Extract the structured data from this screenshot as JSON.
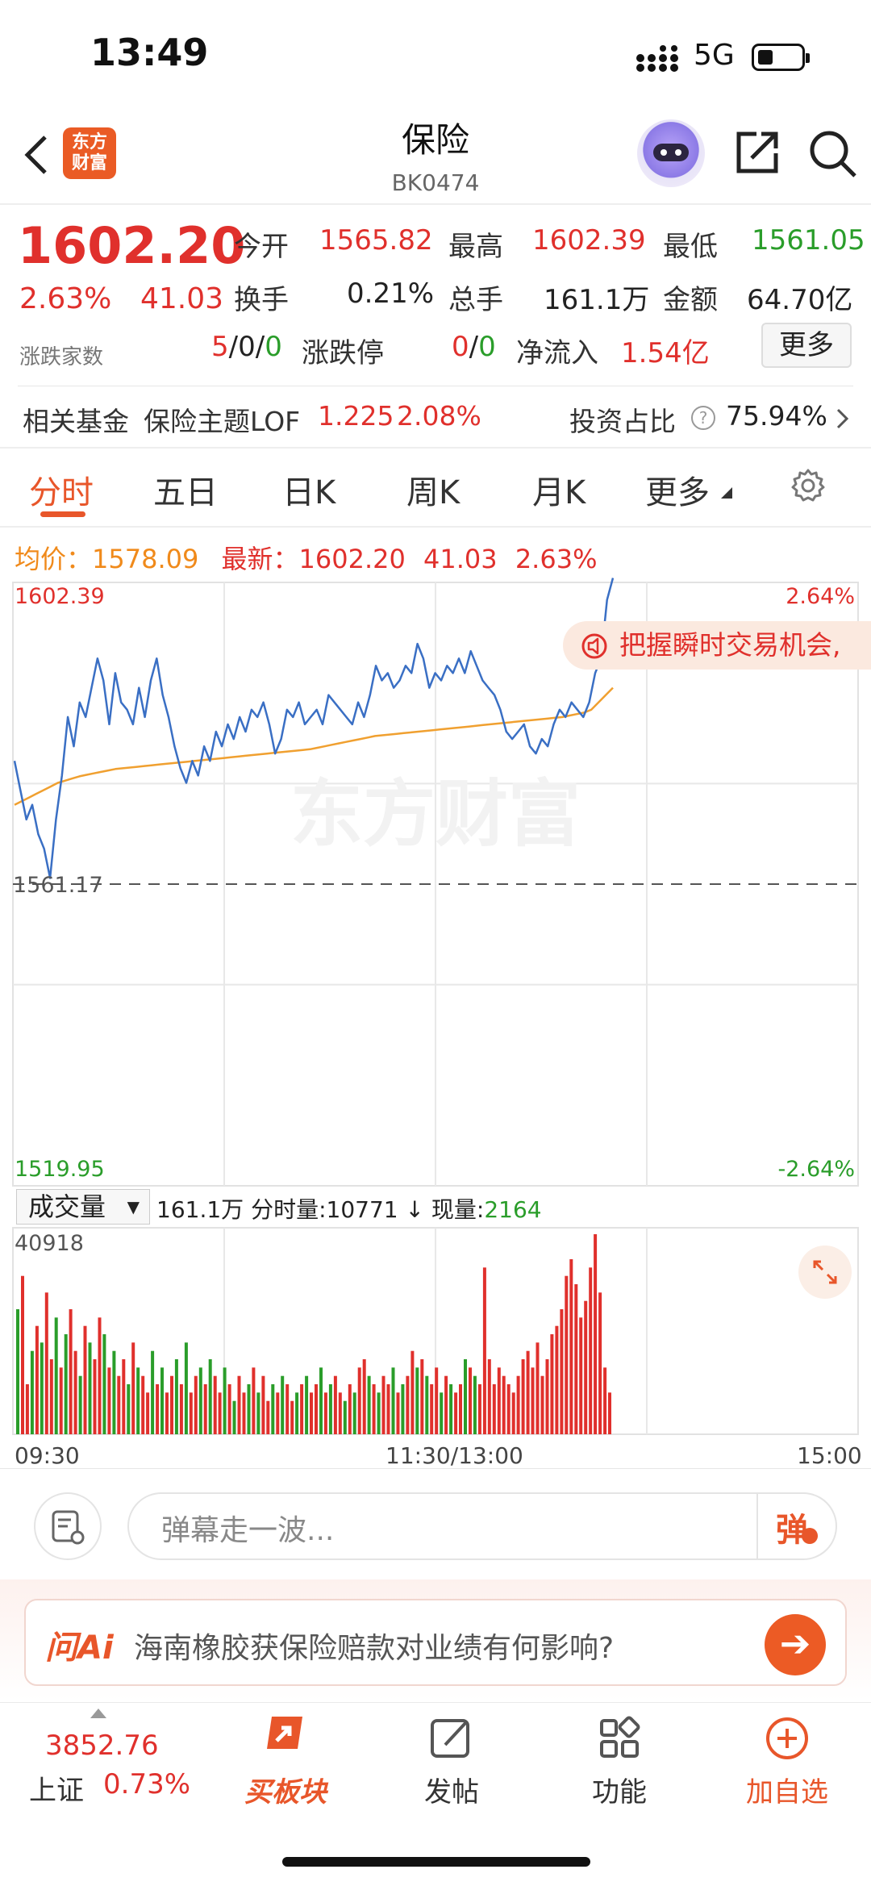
{
  "status_bar": {
    "time": "13:49",
    "network": "5G"
  },
  "header": {
    "logo_text": "东方\n财富",
    "title": "保险",
    "code": "BK0474"
  },
  "quote": {
    "price": "1602.20",
    "change_pct": "2.63%",
    "change": "41.03",
    "rows": [
      [
        {
          "label": "今开",
          "value": "1565.82",
          "color": "#e0302c"
        },
        {
          "label": "最高",
          "value": "1602.39",
          "color": "#e0302c"
        },
        {
          "label": "最低",
          "value": "1561.05",
          "color": "#2a9d2a"
        }
      ],
      [
        {
          "label": "换手",
          "value": "0.21%",
          "color": "#222222"
        },
        {
          "label": "总手",
          "value": "161.1万",
          "color": "#222222"
        },
        {
          "label": "金额",
          "value": "64.70亿",
          "color": "#222222"
        }
      ]
    ],
    "breadth_label": "涨跌家数",
    "breadth": {
      "up": "5",
      "flat": "0",
      "down": "0"
    },
    "limit_label": "涨跌停",
    "limit": {
      "up": "0",
      "down": "0"
    },
    "inflow_label": "净流入",
    "inflow": "1.54亿",
    "more_label": "更多"
  },
  "fund": {
    "label": "相关基金",
    "name": "保险主题LOF",
    "price": "1.225",
    "pct": "2.08%",
    "ratio_label": "投资占比",
    "ratio": "75.94%"
  },
  "tabs": [
    "分时",
    "五日",
    "日K",
    "周K",
    "月K",
    "更多"
  ],
  "avg_row": {
    "avg_label": "均价：",
    "avg": "1578.09",
    "latest_label": "最新：",
    "latest": "1602.20",
    "chg": "41.03",
    "pct": "2.63%"
  },
  "chart_labels": {
    "y_top": "1602.39",
    "y_pre": "1561.17",
    "y_bot": "1519.95",
    "pct_top": "2.64%",
    "pct_bot": "-2.64%",
    "watermark": "东方财富"
  },
  "banner_text": "把握瞬时交易机会,",
  "volume": {
    "select": "成交量",
    "total": "161.1万",
    "minute_label": "分时量:",
    "minute": "10771",
    "arrow": "↓",
    "now_label": "现量:",
    "now": "2164",
    "max": "40918"
  },
  "time_axis": {
    "start": "09:30",
    "mid": "11:30/13:00",
    "end": "15:00"
  },
  "danmaku": {
    "placeholder": "弹幕走一波...",
    "button": "弹"
  },
  "ai": {
    "logo": "问Ai",
    "question": "海南橡胶获保险赔款对业绩有何影响?"
  },
  "nav": {
    "index_value": "3852.76",
    "index_name": "上证",
    "index_pct": "0.73%",
    "items": [
      "买板块",
      "发帖",
      "功能",
      "加自选"
    ]
  },
  "colors": {
    "up": "#e0302c",
    "down": "#2a9d2a",
    "accent": "#e8562a",
    "price_line": "#3a6fc4",
    "avg_line": "#f0a030"
  },
  "chart_data": {
    "type": "line",
    "pre_close": 1561.17,
    "ylim": [
      1519.95,
      1602.39
    ],
    "series": [
      {
        "values": [
          1578,
          1574,
          1570,
          1572,
          1568,
          1566,
          1562,
          1570,
          1576,
          1584,
          1580,
          1586,
          1584,
          1588,
          1592,
          1589,
          1583,
          1590,
          1586,
          1585,
          1583,
          1588,
          1584,
          1589,
          1592,
          1587,
          1584,
          1580,
          1577,
          1575,
          1578,
          1576,
          1580,
          1578,
          1582,
          1580,
          1583,
          1581,
          1584,
          1582,
          1585,
          1584,
          1586,
          1583,
          1579,
          1581,
          1585,
          1584,
          1586,
          1583,
          1584,
          1585,
          1583,
          1587,
          1586,
          1585,
          1584,
          1583,
          1586,
          1584,
          1587,
          1591,
          1589,
          1590,
          1588,
          1589,
          1591,
          1590,
          1594,
          1592,
          1588,
          1590,
          1589,
          1591,
          1590,
          1592,
          1590,
          1593,
          1591,
          1589,
          1588,
          1587,
          1585,
          1582,
          1581,
          1582,
          1583,
          1580,
          1579,
          1581,
          1580,
          1583,
          1585,
          1584,
          1586,
          1585,
          1584,
          1586,
          1590,
          1592,
          1600,
          1603
        ]
      },
      {
        "values": [
          1572,
          1572.5,
          1573,
          1573.5,
          1574,
          1574.5,
          1575,
          1575.3,
          1575.6,
          1575.9,
          1576.1,
          1576.3,
          1576.5,
          1576.7,
          1576.9,
          1577,
          1577.1,
          1577.2,
          1577.3,
          1577.4,
          1577.5,
          1577.6,
          1577.7,
          1577.8,
          1577.9,
          1578,
          1578.1,
          1578.2,
          1578.3,
          1578.4,
          1578.5,
          1578.6,
          1578.7,
          1578.8,
          1578.9,
          1579,
          1579.1,
          1579.2,
          1579.3,
          1579.4,
          1579.5,
          1579.6,
          1579.8,
          1580,
          1580.2,
          1580.4,
          1580.6,
          1580.8,
          1581,
          1581.2,
          1581.4,
          1581.5,
          1581.6,
          1581.7,
          1581.8,
          1581.9,
          1582,
          1582.1,
          1582.2,
          1582.3,
          1582.4,
          1582.5,
          1582.6,
          1582.7,
          1582.8,
          1582.9,
          1583,
          1583.1,
          1583.2,
          1583.3,
          1583.4,
          1583.5,
          1583.6,
          1583.7,
          1583.8,
          1583.9,
          1584,
          1584.2,
          1584.4,
          1584.6,
          1585,
          1586,
          1587,
          1588
        ]
      }
    ],
    "volume_bars": [
      30,
      38,
      12,
      20,
      26,
      22,
      34,
      18,
      28,
      16,
      24,
      30,
      20,
      14,
      26,
      22,
      18,
      28,
      24,
      16,
      20,
      14,
      18,
      12,
      22,
      16,
      14,
      10,
      20,
      12,
      16,
      10,
      14,
      18,
      12,
      22,
      10,
      14,
      16,
      12,
      18,
      14,
      10,
      16,
      12,
      8,
      14,
      10,
      12,
      16,
      10,
      14,
      8,
      12,
      10,
      14,
      12,
      8,
      10,
      12,
      14,
      10,
      12,
      16,
      10,
      12,
      14,
      10,
      8,
      12,
      10,
      16,
      18,
      14,
      12,
      10,
      14,
      12,
      16,
      10,
      12,
      14,
      20,
      16,
      18,
      14,
      12,
      16,
      10,
      14,
      12,
      10,
      12,
      18,
      16,
      14,
      12,
      40,
      18,
      12,
      16,
      14,
      12,
      10,
      14,
      18,
      20,
      16,
      22,
      14,
      18,
      24,
      26,
      30,
      38,
      42,
      36,
      28,
      32,
      40,
      48,
      34,
      16,
      10
    ]
  }
}
